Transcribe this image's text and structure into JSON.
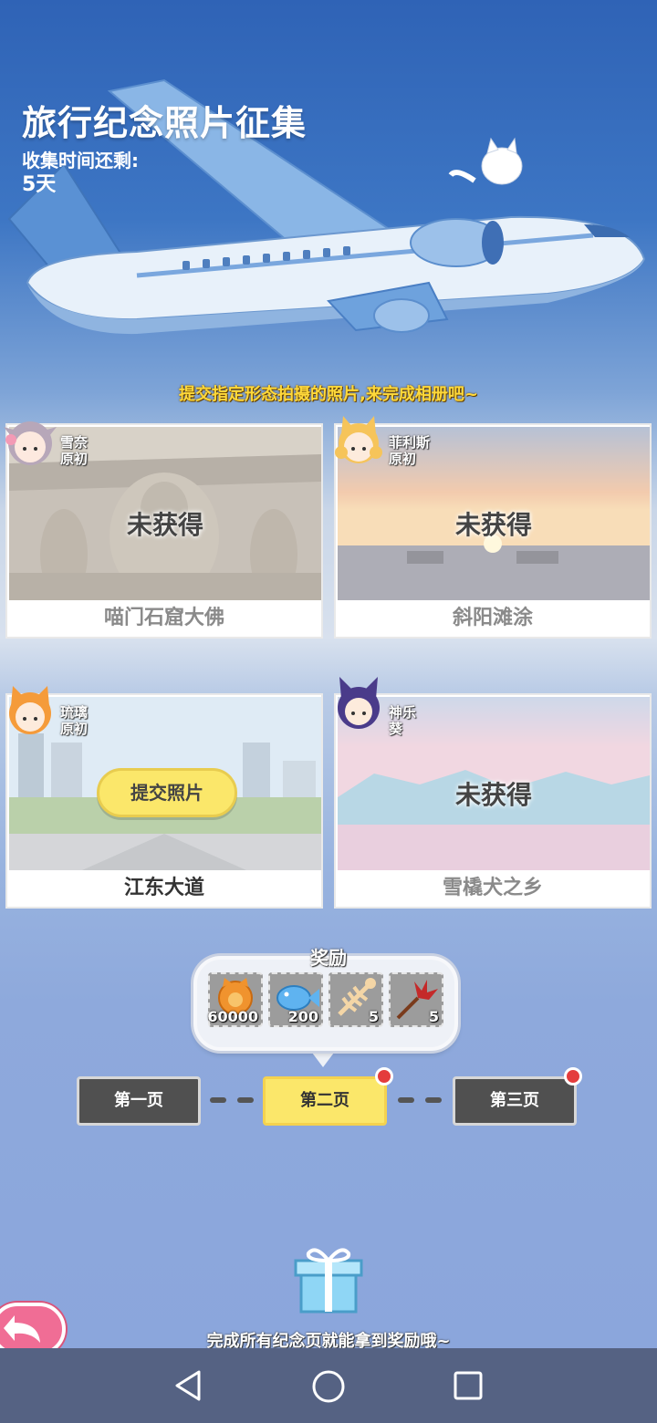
{
  "header": {
    "title": "旅行纪念照片征集",
    "countdown_label": "收集时间还剩:",
    "countdown_value": "5天"
  },
  "instruction": "提交指定形态拍摄的照片,来完成相册吧~",
  "cards": [
    {
      "character_name": "雪奈",
      "character_form": "原初",
      "status": "未获得",
      "caption": "喵门石窟大佛",
      "obtained": false
    },
    {
      "character_name": "菲利斯",
      "character_form": "原初",
      "status": "未获得",
      "caption": "斜阳滩涂",
      "obtained": false
    },
    {
      "character_name": "琉璃",
      "character_form": "原初",
      "status": "",
      "button_label": "提交照片",
      "caption": "江东大道",
      "obtained": false
    },
    {
      "character_name": "神乐",
      "character_form": "葵",
      "status": "未获得",
      "caption": "雪橇犬之乡",
      "obtained": false
    }
  ],
  "rewards": {
    "title": "奖励",
    "items": [
      {
        "icon": "cat-coin-icon",
        "count": "60000"
      },
      {
        "icon": "blue-fish-icon",
        "count": "200"
      },
      {
        "icon": "fish-bone-icon",
        "count": "5"
      },
      {
        "icon": "red-flower-icon",
        "count": "5"
      }
    ]
  },
  "pager": {
    "pages": [
      {
        "label": "第一页",
        "active": false,
        "has_notice": false
      },
      {
        "label": "第二页",
        "active": true,
        "has_notice": true
      },
      {
        "label": "第三页",
        "active": false,
        "has_notice": true
      }
    ]
  },
  "footer": {
    "gift_icon": "gift-box-icon",
    "message": "完成所有纪念页就能拿到奖励哦~",
    "back_icon": "back-arrow-icon"
  },
  "system_nav": {
    "buttons": [
      "back-triangle-icon",
      "home-circle-icon",
      "recents-square-icon"
    ]
  },
  "colors": {
    "accent_yellow": "#fbe76a",
    "page_dark": "#505050",
    "notice_red": "#e43c3c",
    "back_pink": "#f06d95"
  }
}
